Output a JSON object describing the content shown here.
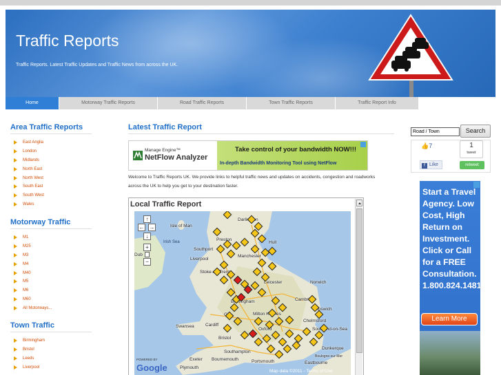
{
  "site": {
    "title": "Traffic Reports",
    "tagline": "Traffic Reports. Latest Traffic Updates and Traffic News from across the UK."
  },
  "nav": {
    "items": [
      "Home",
      "Motorway Traffic Reports",
      "Road Traffic Reports",
      "Town Traffic Reports",
      "Traffic Report Info"
    ],
    "active": "Home"
  },
  "sidebar": {
    "area": {
      "heading": "Area Traffic Reports",
      "items": [
        "East Anglia",
        "London",
        "Midlands",
        "North East",
        "North West",
        "South East",
        "South West",
        "Wales"
      ]
    },
    "motorway": {
      "heading": "Motorway Traffic",
      "items": [
        "M1",
        "M25",
        "M3",
        "M4",
        "M40",
        "M5",
        "M6",
        "M60",
        "All Motorways..."
      ]
    },
    "town": {
      "heading": "Town Traffic",
      "items": [
        "Birmingham",
        "Bristol",
        "Leeds",
        "Liverpool"
      ]
    }
  },
  "main": {
    "heading": "Latest Traffic Report",
    "intro": "Welcome to Traffic Reports UK. We provide links to helpful traffic news and updates on accidents, congestion and roadworks across the UK to help you get to your destination faster.",
    "local_title": "Local Traffic Report"
  },
  "banner_ad": {
    "brand_small": "Manage Engine™",
    "brand_large": "NetFlow Analyzer",
    "headline": "Take control of your bandwidth NOW!!!",
    "subline": "In-depth Bandwidth Monitoring Tool using NetFlow"
  },
  "map": {
    "labels": {
      "isle_of_man": "Isle of Man",
      "irish_sea": "Irish Sea",
      "preston": "Preston",
      "southport": "Southport",
      "liverpool": "Liverpool",
      "manchester": "Manchester",
      "hull": "Hull",
      "darlington": "Darlington",
      "stoke": "Stoke-on-Trent",
      "leicester": "Leicester",
      "norwich": "Norwich",
      "birmingham": "Birmingham",
      "cambridge": "Cambri",
      "ipswich": "Ipswich",
      "milton_keynes": "Milton Keynes",
      "gloucester": "Glo",
      "chelmsford": "Chelmsford",
      "southend": "Southend-on-Sea",
      "swansea": "Swansea",
      "cardiff": "Cardiff",
      "bristol": "Bristol",
      "oxford": "Oxford",
      "southampton": "Southampton",
      "exeter": "Exeter",
      "bournemouth": "Bournemouth",
      "portsmouth": "Portsmouth",
      "plymouth": "Plymouth",
      "eastbourne": "Eastbourne",
      "dunkerque": "Dunkerque",
      "boulogne": "Boulogne-sur-Mer",
      "dublin": "Dub"
    },
    "powered_by": "POWERED BY",
    "logo": "Google",
    "attribution": "Map data ©2011 - Terms of Use"
  },
  "search": {
    "value": "Road / Town",
    "button": "Search"
  },
  "share": {
    "like_count": "7",
    "like_label": "Like",
    "tweet_count": "1",
    "tweet_word": "tweet",
    "retweet_label": "retweet"
  },
  "side_ad": {
    "text": "Start a Travel Agency. Low Cost, High Return on Investment. Click or Call for a FREE Consultation. 1.800.824.1481",
    "button": "Learn More"
  },
  "colors": {
    "accent": "#1f6fc8",
    "nav_active": "#2f7fd6",
    "link": "#d04a00"
  }
}
